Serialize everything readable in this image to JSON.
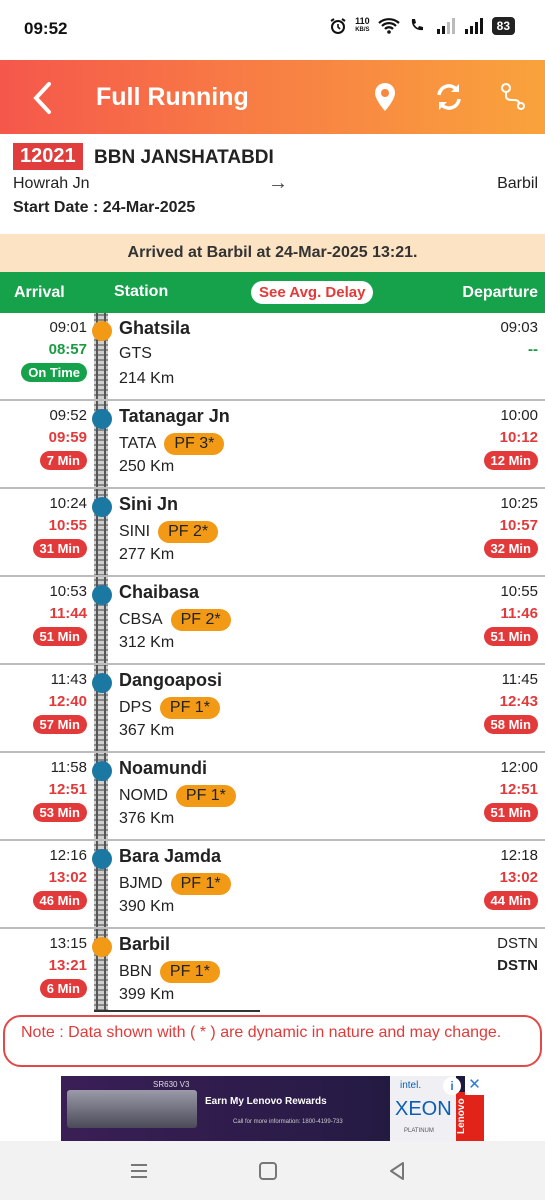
{
  "status_bar": {
    "time": "09:52",
    "net_speed": "110",
    "net_unit": "KB/S",
    "battery": "83"
  },
  "app_bar": {
    "title": "Full Running"
  },
  "train": {
    "number": "12021",
    "name": "BBN JANSHATABDI",
    "from": "Howrah Jn",
    "to": "Barbil",
    "start_date": "Start Date : 24-Mar-2025"
  },
  "arrival_banner": "Arrived at Barbil at 24-Mar-2025 13:21.",
  "table_header": {
    "arrival": "Arrival",
    "station": "Station",
    "delay_button": "See Avg. Delay",
    "departure": "Departure"
  },
  "stations": [
    {
      "sch_arr": "09:01",
      "act_arr": "08:57",
      "arr_badge": "On Time",
      "name": "Ghatsila",
      "code": "GTS",
      "pf": "",
      "km": "214 Km",
      "sch_dep": "09:03",
      "act_dep": "--",
      "dep_badge": ""
    },
    {
      "sch_arr": "09:52",
      "act_arr": "09:59",
      "arr_badge": "7 Min",
      "name": "Tatanagar Jn",
      "code": "TATA",
      "pf": "PF 3*",
      "km": "250 Km",
      "sch_dep": "10:00",
      "act_dep": "10:12",
      "dep_badge": "12 Min"
    },
    {
      "sch_arr": "10:24",
      "act_arr": "10:55",
      "arr_badge": "31 Min",
      "name": "Sini Jn",
      "code": "SINI",
      "pf": "PF 2*",
      "km": "277 Km",
      "sch_dep": "10:25",
      "act_dep": "10:57",
      "dep_badge": "32 Min"
    },
    {
      "sch_arr": "10:53",
      "act_arr": "11:44",
      "arr_badge": "51 Min",
      "name": "Chaibasa",
      "code": "CBSA",
      "pf": "PF 2*",
      "km": "312 Km",
      "sch_dep": "10:55",
      "act_dep": "11:46",
      "dep_badge": "51 Min"
    },
    {
      "sch_arr": "11:43",
      "act_arr": "12:40",
      "arr_badge": "57 Min",
      "name": "Dangoaposi",
      "code": "DPS",
      "pf": "PF 1*",
      "km": "367 Km",
      "sch_dep": "11:45",
      "act_dep": "12:43",
      "dep_badge": "58 Min"
    },
    {
      "sch_arr": "11:58",
      "act_arr": "12:51",
      "arr_badge": "53 Min",
      "name": "Noamundi",
      "code": "NOMD",
      "pf": "PF 1*",
      "km": "376 Km",
      "sch_dep": "12:00",
      "act_dep": "12:51",
      "dep_badge": "51 Min"
    },
    {
      "sch_arr": "12:16",
      "act_arr": "13:02",
      "arr_badge": "46 Min",
      "name": "Bara Jamda",
      "code": "BJMD",
      "pf": "PF 1*",
      "km": "390 Km",
      "sch_dep": "12:18",
      "act_dep": "13:02",
      "dep_badge": "44 Min"
    },
    {
      "sch_arr": "13:15",
      "act_arr": "13:21",
      "arr_badge": "6 Min",
      "name": "Barbil",
      "code": "BBN",
      "pf": "PF 1*",
      "km": "399 Km",
      "sch_dep": "DSTN",
      "act_dep": "DSTN",
      "dep_badge": ""
    }
  ],
  "note": "Note : Data shown with ( * ) are dynamic in nature and may change.",
  "ad": {
    "model": "SR630 V3",
    "headline": "Earn My Lenovo Rewards",
    "sub": "Call for more information: 1800-4199-733",
    "intel": "intel.",
    "xeon": "XEON",
    "platinum": "PLATINUM",
    "lenovo": "Lenovo"
  },
  "colors": {
    "accent_red": "#e23a3a",
    "header_green": "#16a14b",
    "dot_blue": "#1b78a2",
    "dot_orange": "#f29a16",
    "banner_bg": "#fbe3c3"
  }
}
